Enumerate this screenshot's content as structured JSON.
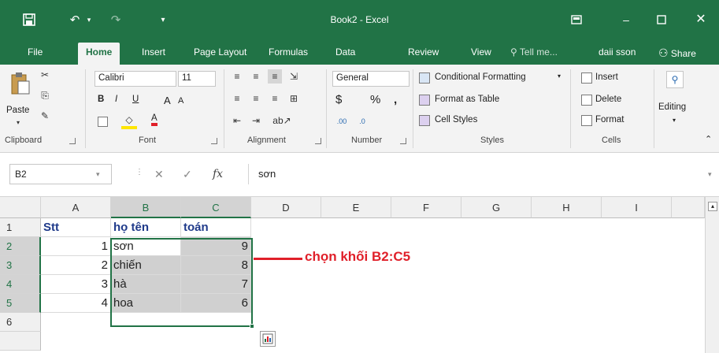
{
  "app": {
    "title": "Book2 - Excel",
    "brand_color": "#217346",
    "window_controls": [
      "ribbon-display-icon",
      "minimize-icon",
      "maximize-icon",
      "close-icon"
    ]
  },
  "quick_access": {
    "icons": [
      "save-icon",
      "undo-icon",
      "redo-icon",
      "customize-icon"
    ]
  },
  "tabs": [
    "File",
    "Home",
    "Insert",
    "Page Layout",
    "Formulas",
    "Data",
    "Review",
    "View"
  ],
  "active_tab": "Home",
  "tell_me": "Tell me...",
  "user": "daii sson",
  "share": "Share",
  "ribbon": {
    "clipboard": {
      "label": "Clipboard",
      "paste": "Paste"
    },
    "font": {
      "label": "Font",
      "name": "Calibri",
      "size": "11",
      "bold": "B",
      "italic": "I",
      "underline": "U",
      "grow": "A",
      "shrink": "A",
      "font_color": "A"
    },
    "alignment": {
      "label": "Alignment"
    },
    "number": {
      "label": "Number",
      "format": "General",
      "currency": "$",
      "percent": "%",
      "comma": ","
    },
    "styles": {
      "label": "Styles",
      "conditional": "Conditional Formatting",
      "format_table": "Format as Table",
      "cell_styles": "Cell Styles"
    },
    "cells": {
      "label": "Cells",
      "insert": "Insert",
      "delete": "Delete",
      "format": "Format"
    },
    "editing": {
      "label": "Editing"
    }
  },
  "formula_bar": {
    "name_box": "B2",
    "fx": "fx",
    "content": "sơn"
  },
  "columns": [
    "A",
    "B",
    "C",
    "D",
    "E",
    "F",
    "G",
    "H",
    "I"
  ],
  "rows": [
    "1",
    "2",
    "3",
    "4",
    "5",
    "6"
  ],
  "cells": {
    "A1": "Stt",
    "B1": "họ tên",
    "C1": "toán",
    "A2": "1",
    "B2": "sơn",
    "C2": "9",
    "A3": "2",
    "B3": "chiến",
    "C3": "8",
    "A4": "3",
    "B4": "hà",
    "C4": "7",
    "A5": "4",
    "B5": "hoa",
    "C5": "6"
  },
  "annotation": {
    "text": "chọn khối B2:C5",
    "color": "#e0202a"
  },
  "selection": "B2:C5"
}
